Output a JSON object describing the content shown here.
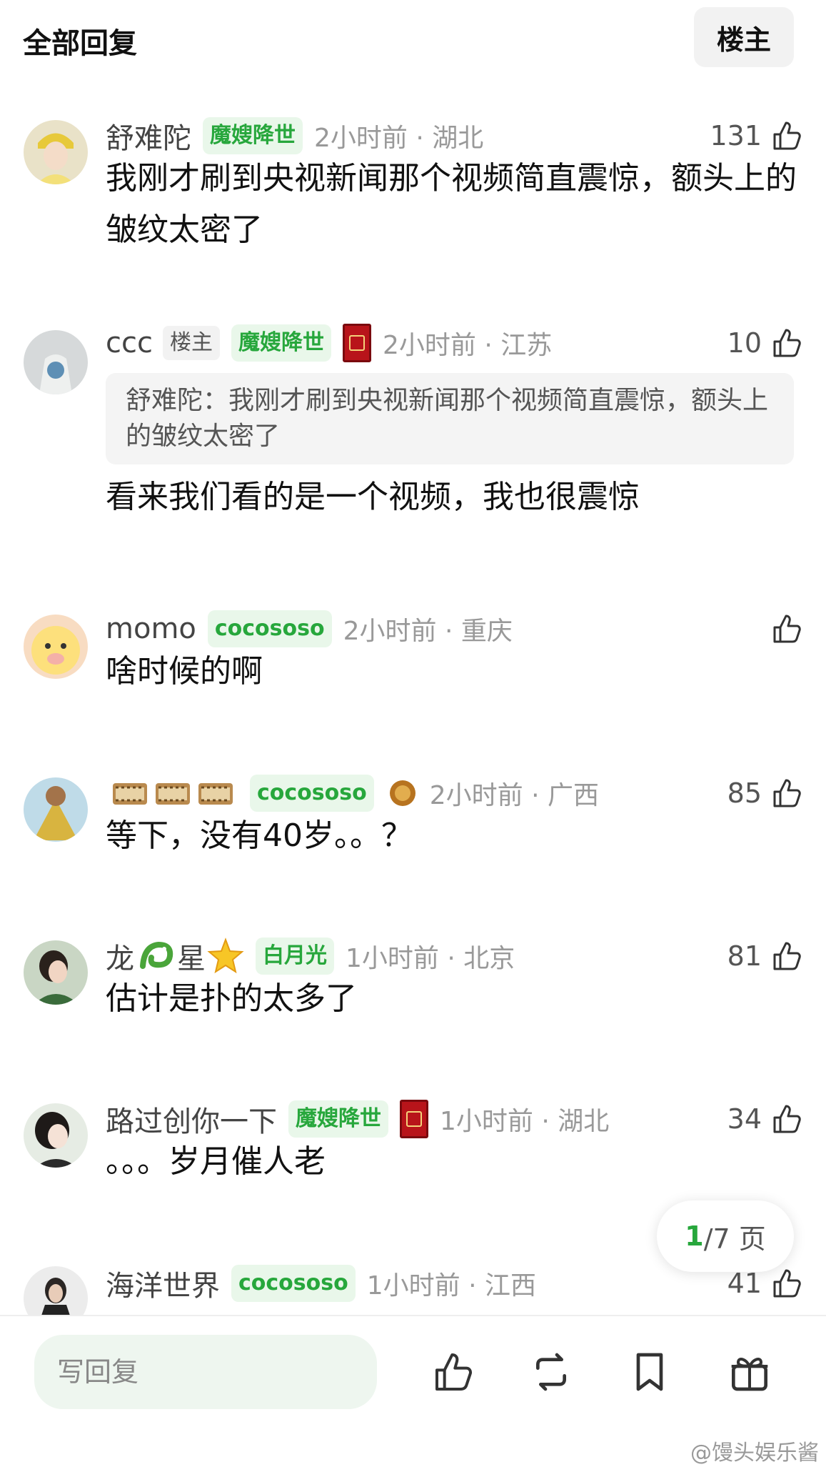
{
  "header": {
    "title": "全部回复",
    "op_button": "楼主"
  },
  "comments": [
    {
      "user": "舒难陀",
      "badge": "魔嫂降世",
      "meta": "2小时前 · 湖北",
      "likes": "131",
      "text": "我刚才刷到央视新闻那个视频简直震惊，额头上的皱纹太密了"
    },
    {
      "user": "ccc",
      "op_tag": "楼主",
      "badge": "魔嫂降世",
      "meta": "2小时前 · 江苏",
      "likes": "10",
      "quote": "舒难陀：我刚才刷到央视新闻那个视频简直震惊，额头上的皱纹太密了",
      "text": "看来我们看的是一个视频，我也很震惊"
    },
    {
      "user": "momo",
      "badge": "cocososo",
      "meta": "2小时前 · 重庆",
      "likes": "",
      "text": "啥时候的啊"
    },
    {
      "user": "",
      "badge": "cocososo",
      "meta": "2小时前 · 广西",
      "likes": "85",
      "text": "等下，没有40岁。。？"
    },
    {
      "user_a": "龙",
      "user_b": "星",
      "badge": "白月光",
      "meta": "1小时前 · 北京",
      "likes": "81",
      "text": "估计是扑的太多了"
    },
    {
      "user": "路过创你一下",
      "badge": "魔嫂降世",
      "meta": "1小时前 · 湖北",
      "likes": "34",
      "text": "。。。岁月催人老"
    },
    {
      "user": "海洋世界",
      "badge": "cocososo",
      "meta": "1小时前 · 江西",
      "likes": "41",
      "text": ""
    }
  ],
  "pager": {
    "current": "1",
    "total": "/7 页"
  },
  "bottom": {
    "reply_placeholder": "写回复"
  },
  "watermark": "@馒头娱乐酱",
  "colors": {
    "accent": "#27a73c",
    "badge_bg": "#e9f7ea",
    "meta": "#999999"
  }
}
